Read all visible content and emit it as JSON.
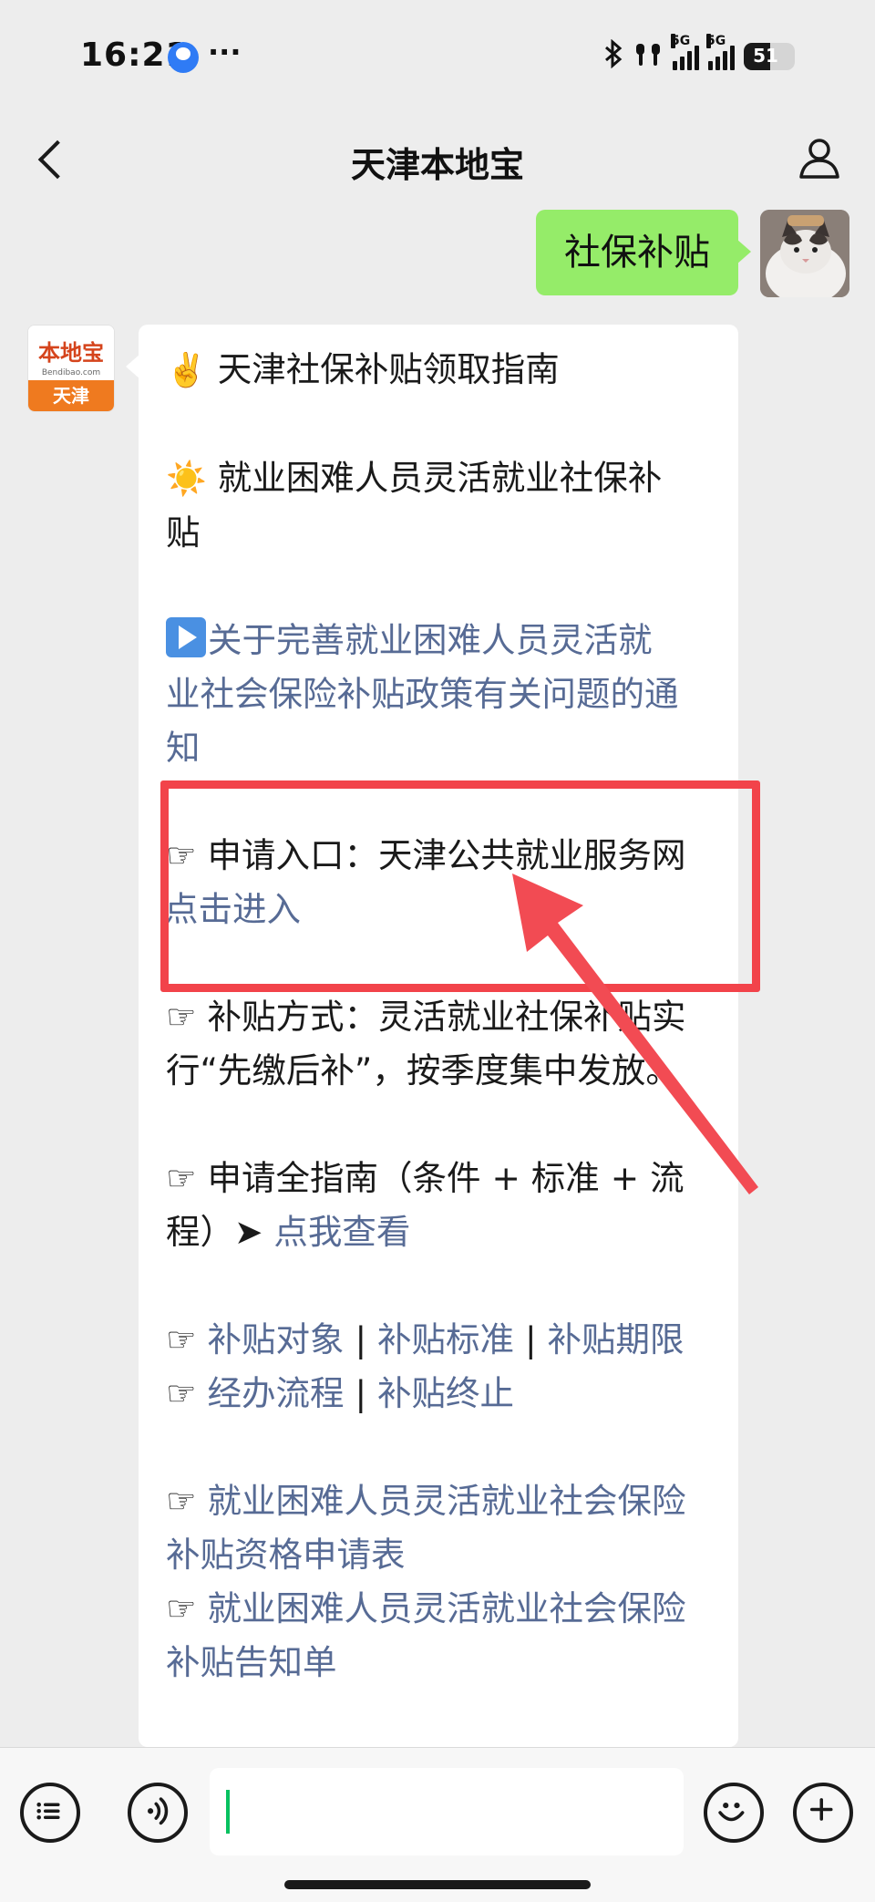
{
  "status_bar": {
    "time": "16:21",
    "dots": "···",
    "network_a": "5G",
    "network_b": "5G",
    "battery": "51",
    "battery_level": 0.51
  },
  "nav": {
    "title": "天津本地宝",
    "back_icon": "chevron-left-icon",
    "profile_icon": "person-icon"
  },
  "user_message": {
    "text": "社保补贴"
  },
  "bot_avatar": {
    "brand": "本地宝",
    "domain": "Bendibao.com",
    "city": "天津"
  },
  "bot_message": {
    "title_emoji": "✌️",
    "title": "天津社保补贴领取指南",
    "section_emoji": "☀️",
    "section_line1": "就业困难人员灵活就业社保补",
    "section_line2": "贴",
    "notice_line1": "关于完善就业困难人员灵活就",
    "notice_line2": "业社会保险补贴政策有关问题的通",
    "notice_line3": "知",
    "hand": "☞",
    "apply_entry": "申请入口：天津公共就业服务网",
    "apply_link": "点击进入",
    "method_line1": "补贴方式：灵活就业社保补贴实",
    "method_line2": "行“先缴后补”，按季度集中发放。",
    "guide_line1": "申请全指南（条件 + 标准 + 流",
    "guide_line2_prefix": "程）➤",
    "guide_link": "点我查看",
    "sep": "|",
    "link_target": "补贴对象",
    "link_standard": "补贴标准",
    "link_period": "补贴期限",
    "link_process": "经办流程",
    "link_terminate": "补贴终止",
    "form1_line1": "就业困难人员灵活就业社会保险",
    "form1_line2": "补贴资格申请表",
    "form2_line1": "就业困难人员灵活就业社会保险",
    "form2_line2": "补贴告知单"
  },
  "bottom_bar": {
    "menu_icon": "list-menu-icon",
    "voice_icon": "voice-icon",
    "emoji_icon": "emoji-icon",
    "plus_icon": "plus-icon",
    "input_value": ""
  },
  "colors": {
    "background": "#ededed",
    "user_bubble": "#95ec69",
    "link": "#576b95",
    "highlight": "#f2434a",
    "cursor": "#07c160"
  }
}
